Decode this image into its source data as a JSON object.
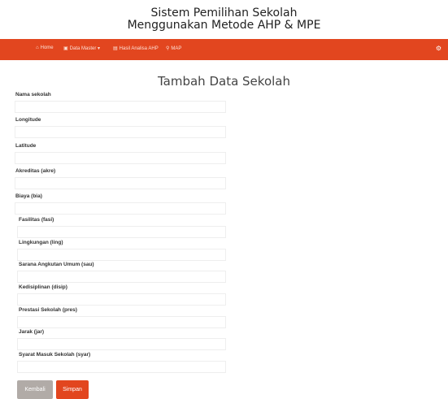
{
  "header": {
    "title_line1": "Sistem Pemilihan Sekolah",
    "title_line2": "Menggunakan Metode AHP & MPE"
  },
  "navbar": {
    "items": [
      {
        "icon": "home-icon",
        "glyph": "⌂",
        "label": "Home"
      },
      {
        "icon": "database-icon",
        "glyph": "▣",
        "label": "Data Master ▾"
      },
      {
        "icon": "calculator-icon",
        "glyph": "▤",
        "label": "Hasil Analisa AHP"
      },
      {
        "icon": "map-pin-icon",
        "glyph": "⚲",
        "label": "MAP"
      }
    ],
    "settings_glyph": "⚙"
  },
  "page": {
    "title": "Tambah Data Sekolah"
  },
  "form": {
    "fields": [
      {
        "label": "Nama sekolah",
        "value": ""
      },
      {
        "label": "Longitude",
        "value": ""
      },
      {
        "label": "Latitude",
        "value": ""
      },
      {
        "label": "Akreditas (akre)",
        "value": ""
      },
      {
        "label": "Biaya (bia)",
        "value": ""
      },
      {
        "label": "Fasilitas (fasi)",
        "value": ""
      },
      {
        "label": "Lingkungan (ling)",
        "value": ""
      },
      {
        "label": "Sarana Angkutan Umum (sau)",
        "value": ""
      },
      {
        "label": "Kedisiplinan (disip)",
        "value": ""
      },
      {
        "label": "Prestasi Sekolah (pres)",
        "value": ""
      },
      {
        "label": "Jarak (jar)",
        "value": ""
      },
      {
        "label": "Syarat Masuk Sekolah (syar)",
        "value": ""
      }
    ]
  },
  "buttons": {
    "back": "Kembali",
    "save": "Simpan"
  },
  "colors": {
    "nav_bg": "#e2461f",
    "save_bg": "#e2461f",
    "back_bg": "#b1aba7"
  }
}
